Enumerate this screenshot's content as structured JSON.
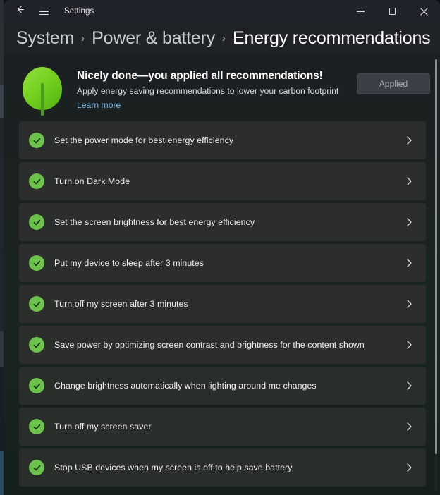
{
  "window": {
    "app_title": "Settings",
    "back_icon": "back-arrow-icon",
    "menu_icon": "hamburger-menu-icon",
    "controls": {
      "minimize": "minimize-icon",
      "maximize": "maximize-icon",
      "close": "close-icon"
    }
  },
  "breadcrumb": {
    "separator": "›",
    "items": [
      {
        "label": "System",
        "current": false
      },
      {
        "label": "Power & battery",
        "current": false
      },
      {
        "label": "Energy recommendations",
        "current": true
      }
    ]
  },
  "hero": {
    "icon": "leaf-icon",
    "title": "Nicely done—you applied all recommendations!",
    "subtitle": "Apply energy saving recommendations to lower your carbon footprint",
    "link_label": "Learn more",
    "button_label": "Applied",
    "button_state": "disabled"
  },
  "recommendations": [
    {
      "label": "Set the power mode for best energy efficiency",
      "state": "applied"
    },
    {
      "label": "Turn on Dark Mode",
      "state": "applied"
    },
    {
      "label": "Set the screen brightness for best energy efficiency",
      "state": "applied"
    },
    {
      "label": "Put my device to sleep after 3 minutes",
      "state": "applied"
    },
    {
      "label": "Turn off my screen after 3 minutes",
      "state": "applied"
    },
    {
      "label": "Save power by optimizing screen contrast and brightness for the content shown",
      "state": "applied"
    },
    {
      "label": "Change brightness automatically when lighting around me changes",
      "state": "applied"
    },
    {
      "label": "Turn off my screen saver",
      "state": "applied"
    },
    {
      "label": "Stop USB devices when my screen is off to help save battery",
      "state": "applied"
    }
  ],
  "colors": {
    "accent_green": "#6cc24a",
    "leaf_light": "#7ed321",
    "leaf_dark": "#4a9c1e",
    "link_blue": "#76b9e8",
    "row_background": "#2b2e2c",
    "page_background": "#1b1f22",
    "window_background": "#1f2328"
  },
  "scrollbar": {
    "name": "vertical-scrollbar",
    "position": "top"
  }
}
